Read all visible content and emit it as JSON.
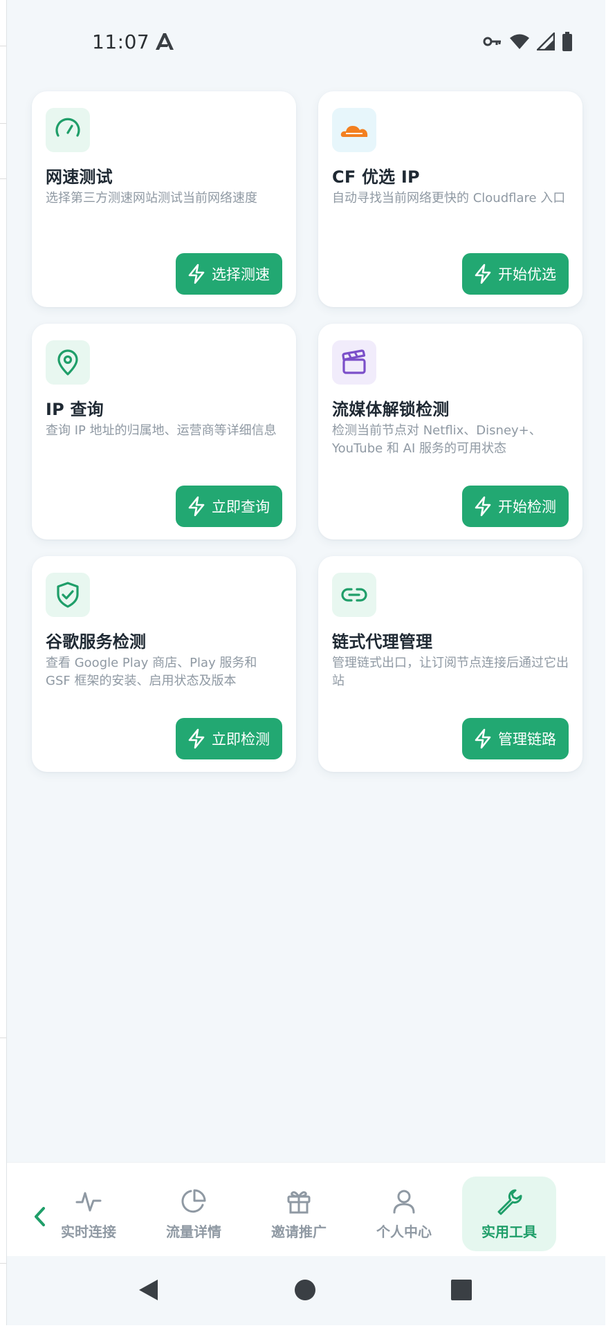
{
  "status_bar": {
    "time": "11:07"
  },
  "tools": [
    {
      "id": "speed-test",
      "icon": "speedometer-icon",
      "icon_color": "#1f9e69",
      "title": "网速测试",
      "description": "选择第三方测速网站测试当前网络速度",
      "action": "选择测速"
    },
    {
      "id": "cf-ip",
      "icon": "cloud-icon",
      "icon_color": "#f38020",
      "title": "CF 优选 IP",
      "description": "自动寻找当前网络更快的 Cloudflare 入口",
      "action": "开始优选"
    },
    {
      "id": "ip-lookup",
      "icon": "map-pin-icon",
      "icon_color": "#1f9e69",
      "title": "IP 查询",
      "description": "查询 IP 地址的归属地、运营商等详细信息",
      "action": "立即查询"
    },
    {
      "id": "streaming-unlock",
      "icon": "clapperboard-icon",
      "icon_color": "#7b4fc9",
      "title": "流媒体解锁检测",
      "description": "检测当前节点对 Netflix、Disney+、YouTube 和 AI 服务的可用状态",
      "action": "开始检测"
    },
    {
      "id": "google-services",
      "icon": "shield-check-icon",
      "icon_color": "#1f9e69",
      "title": "谷歌服务检测",
      "description": "查看 Google Play 商店、Play 服务和 GSF 框架的安装、启用状态及版本",
      "action": "立即检测"
    },
    {
      "id": "proxy-chain",
      "icon": "link-icon",
      "icon_color": "#1f9e69",
      "title": "链式代理管理",
      "description": "管理链式出口，让订阅节点连接后通过它出站",
      "action": "管理链路"
    }
  ],
  "bottom_nav": {
    "items": [
      {
        "icon": "activity-icon",
        "label": "实时连接"
      },
      {
        "icon": "pie-chart-icon",
        "label": "流量详情"
      },
      {
        "icon": "gift-icon",
        "label": "邀请推广"
      },
      {
        "icon": "user-icon",
        "label": "个人中心"
      },
      {
        "icon": "wrench-icon",
        "label": "实用工具"
      }
    ],
    "active_index": 4
  },
  "colors": {
    "accent": "#22a872",
    "accent_dark": "#1f9e69",
    "background": "#f3f7fa"
  }
}
